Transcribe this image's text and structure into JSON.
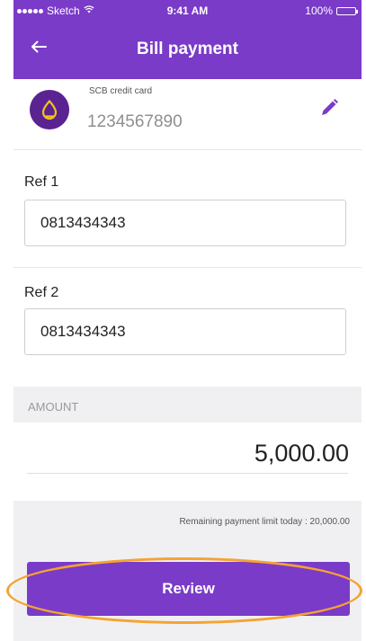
{
  "status_bar": {
    "carrier": "Sketch",
    "time": "9:41 AM",
    "battery": "100%",
    "battery_level": 1.0
  },
  "nav": {
    "title": "Bill payment",
    "back_icon": "arrow-left-icon"
  },
  "card": {
    "name": "SCB credit card",
    "number": "1234567890",
    "logo_icon": "scb-logo-icon",
    "edit_icon": "pencil-icon"
  },
  "ref1": {
    "label": "Ref 1",
    "value": "0813434343"
  },
  "ref2": {
    "label": "Ref 2",
    "value": "0813434343"
  },
  "amount": {
    "label": "AMOUNT",
    "value": "5,000.00"
  },
  "footer": {
    "limit_text": "Remaining payment limit today : 20,000.00",
    "review_label": "Review"
  },
  "colors": {
    "brand_purple": "#7a3bc8",
    "logo_purple": "#5a2391",
    "logo_gold": "#f2c21b",
    "highlight_orange": "#f5a331"
  }
}
